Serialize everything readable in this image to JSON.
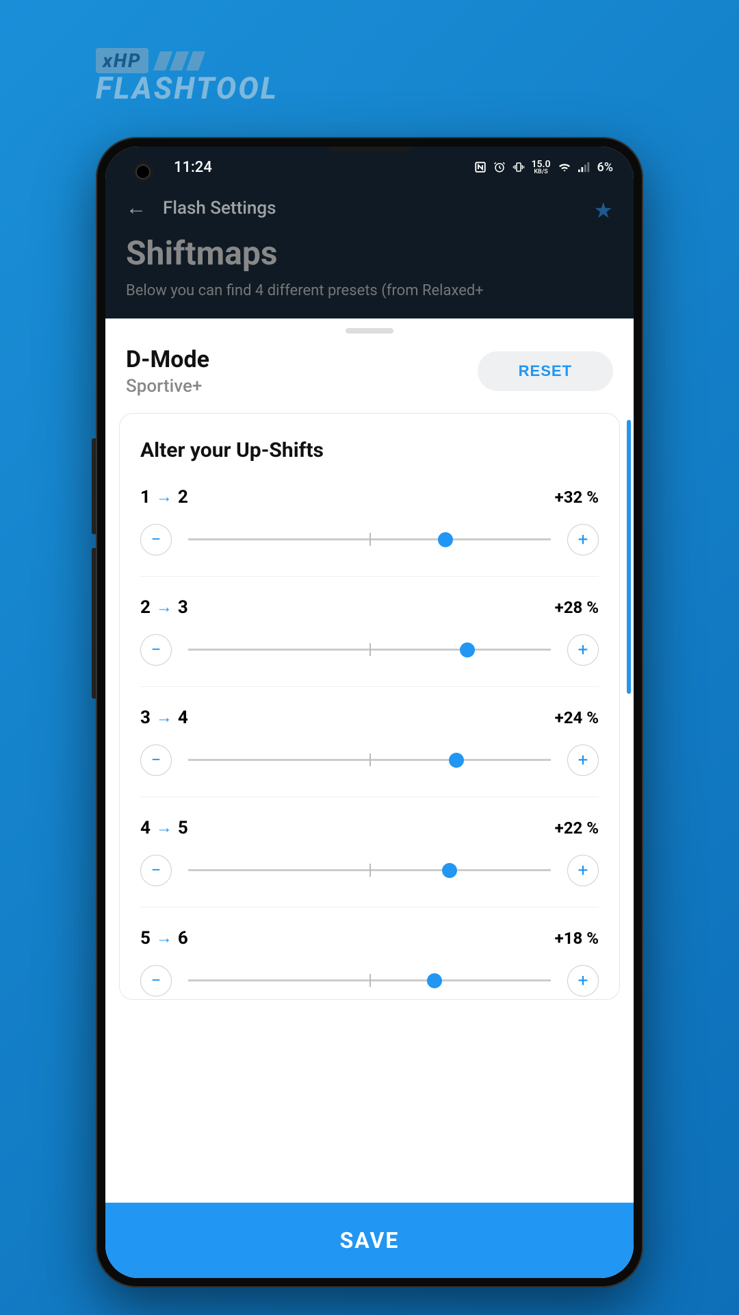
{
  "logo": {
    "badge": "xHP",
    "main": "FLASHTOOL"
  },
  "status": {
    "time": "11:24",
    "speed_value": "15.0",
    "speed_unit": "KB/S",
    "battery": "6%"
  },
  "header": {
    "back_label": "Flash Settings",
    "title": "Shiftmaps",
    "subtitle": "Below you can find 4 different presets (from Relaxed+"
  },
  "sheet": {
    "mode_title": "D-Mode",
    "mode_subtitle": "Sportive+",
    "reset_label": "RESET",
    "card_title": "Alter your Up-Shifts",
    "shifts": [
      {
        "from": "1",
        "to": "2",
        "value": "+32 %",
        "pos": 71
      },
      {
        "from": "2",
        "to": "3",
        "value": "+28 %",
        "pos": 77
      },
      {
        "from": "3",
        "to": "4",
        "value": "+24 %",
        "pos": 74
      },
      {
        "from": "4",
        "to": "5",
        "value": "+22 %",
        "pos": 72
      },
      {
        "from": "5",
        "to": "6",
        "value": "+18 %",
        "pos": 68
      }
    ]
  },
  "save_label": "SAVE"
}
